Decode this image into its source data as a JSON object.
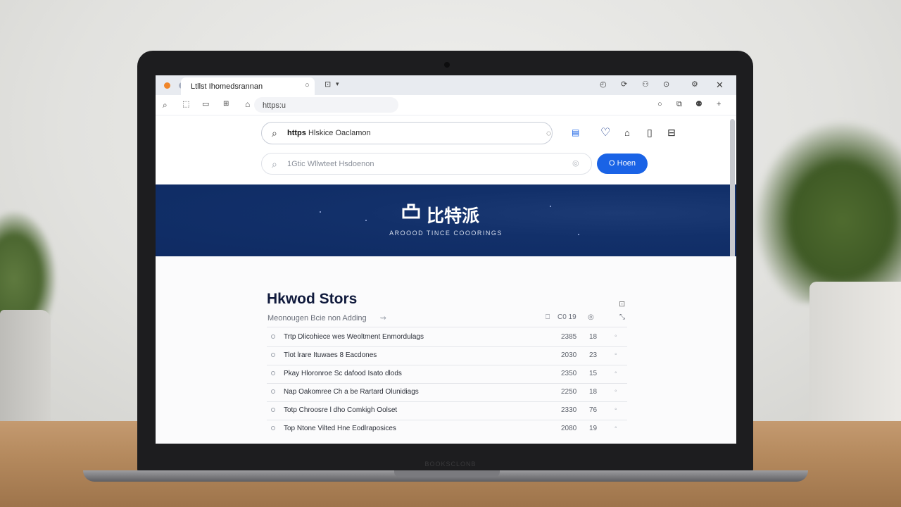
{
  "browser": {
    "tab_title": "Ltllst Ihomedsrannan",
    "tab_close": "○",
    "address_text": "https:u"
  },
  "search": {
    "primary_prefix": "https",
    "primary_text": "Hlskice Oaclamon",
    "secondary_placeholder": "1Gtic Wllwteet Hsdoenon",
    "go_button": "O Hoen"
  },
  "banner": {
    "title": "比特派",
    "subtitle": "AROOOD TINCE COOORINGS"
  },
  "list": {
    "title": "Hkwod Stors",
    "subtitle": "Meonougen Bcie non Adding",
    "header_value": "C0 19",
    "rows": [
      {
        "title": "Trtp Dlicohiece wes Weoltment Enmordulags",
        "year": "2385",
        "count": "18"
      },
      {
        "title": "Tlot lrare Ituwaes 8 Eacdones",
        "year": "2030",
        "count": "23"
      },
      {
        "title": "Pkay Hloronroe Sc dafood Isato dlods",
        "year": "2350",
        "count": "15"
      },
      {
        "title": "Nap Oakomree Ch a be Rartard Olunidiags",
        "year": "2250",
        "count": "18"
      },
      {
        "title": "Totp Chroosre l dho Comkigh Oolset",
        "year": "2330",
        "count": "76"
      },
      {
        "title": "Top Ntone Vilted Hne Eodlraposices",
        "year": "2080",
        "count": "19"
      }
    ]
  },
  "chin_label": "BOOKSCLONB",
  "colors": {
    "accent": "#1a63e6",
    "banner": "#0f2b63",
    "title_text": "#101a3c"
  },
  "icons": [
    "search-icon",
    "tabs-icon",
    "folder-icon",
    "grid-icon",
    "home-icon",
    "heart-icon",
    "bag-icon",
    "bookmark-icon",
    "window-icon",
    "close-icon"
  ]
}
